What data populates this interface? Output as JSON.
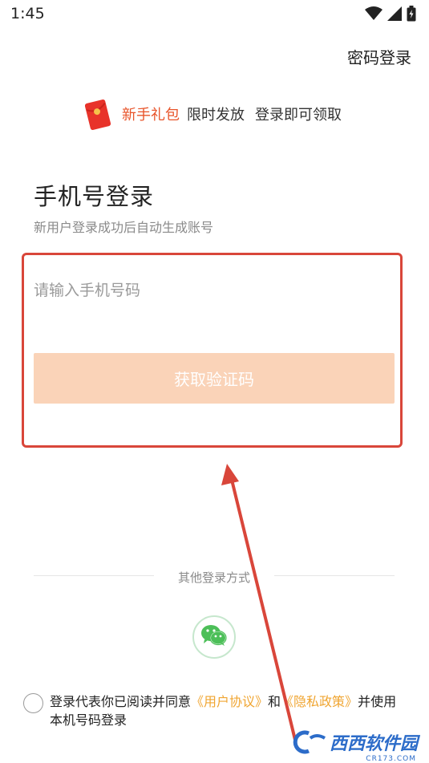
{
  "status_bar": {
    "time": "1:45",
    "icons": [
      "wifi-icon",
      "signal-icon",
      "battery-icon"
    ]
  },
  "header": {
    "password_login": "密码登录"
  },
  "promo": {
    "accent": "新手礼包",
    "text1": "限时发放",
    "text2": "登录即可领取",
    "icon": "red-packet-icon"
  },
  "login": {
    "title": "手机号登录",
    "subtitle": "新用户登录成功后自动生成账号",
    "phone_placeholder": "请输入手机号码",
    "phone_value": "",
    "get_code_label": "获取验证码"
  },
  "other_login": {
    "label": "其他登录方式",
    "wechat_icon": "wechat-icon"
  },
  "agreement": {
    "prefix": "登录代表你已阅读并同意",
    "user_agreement": "《用户协议》",
    "and": "和",
    "privacy_policy": "《隐私政策》",
    "suffix": "并使用本机号码登录",
    "checked": false
  },
  "watermark": {
    "text": "西西软件园",
    "sub": "CR173.COM"
  },
  "colors": {
    "accent": "#e8542a",
    "button_disabled": "#fad3b8",
    "link": "#f0a531",
    "annotation": "#d9463a",
    "wechat": "#4cbf58"
  }
}
